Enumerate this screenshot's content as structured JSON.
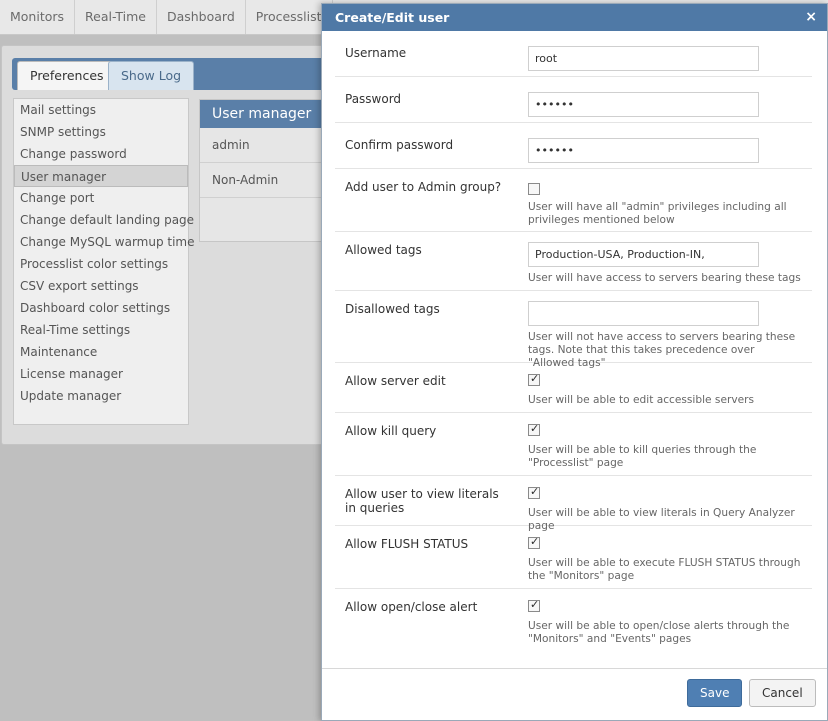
{
  "topnav": [
    "Monitors",
    "Real-Time",
    "Dashboard",
    "Processlist"
  ],
  "tabs": {
    "preferences": "Preferences",
    "show_log": "Show Log"
  },
  "sidemenu": [
    "Mail settings",
    "SNMP settings",
    "Change password",
    "User manager",
    "Change port",
    "Change default landing page",
    "Change MySQL warmup time",
    "Processlist color settings",
    "CSV export settings",
    "Dashboard color settings",
    "Real-Time settings",
    "Maintenance",
    "License manager",
    "Update manager"
  ],
  "user_manager": {
    "title": "User manager",
    "users": [
      "admin",
      "Non-Admin"
    ]
  },
  "modal": {
    "title": "Create/Edit user",
    "close": "×",
    "username": {
      "label": "Username",
      "value": "root"
    },
    "password": {
      "label": "Password",
      "value": "••••••"
    },
    "confirm_password": {
      "label": "Confirm password",
      "value": "••••••"
    },
    "admin_group": {
      "label": "Add user to Admin group?",
      "checked": false,
      "help": "User will have all \"admin\" privileges including all privileges mentioned below"
    },
    "allowed_tags": {
      "label": "Allowed tags",
      "value": "Production-USA, Production-IN,",
      "help": "User will have access to servers bearing these tags"
    },
    "disallowed_tags": {
      "label": "Disallowed tags",
      "value": "",
      "help": "User will not have access to servers bearing these tags. Note that this takes precedence over \"Allowed tags\""
    },
    "server_edit": {
      "label": "Allow server edit",
      "checked": true,
      "help": "User will be able to edit accessible servers"
    },
    "kill_query": {
      "label": "Allow kill query",
      "checked": true,
      "help": "User will be able to kill queries through the \"Processlist\" page"
    },
    "view_literals": {
      "label": "Allow user to view literals in queries",
      "checked": true,
      "help": "User will be able to view literals in Query Analyzer page"
    },
    "flush_status": {
      "label": "Allow FLUSH STATUS",
      "checked": true,
      "help": "User will be able to execute FLUSH STATUS through the \"Monitors\" page"
    },
    "open_close_alert": {
      "label": "Allow open/close alert",
      "checked": true,
      "help": "User will be able to open/close alerts through the \"Monitors\" and \"Events\" pages"
    },
    "save": "Save",
    "cancel": "Cancel"
  },
  "colors": {
    "header_blue": "#4f79a6",
    "save_blue": "#4f7fb3"
  }
}
